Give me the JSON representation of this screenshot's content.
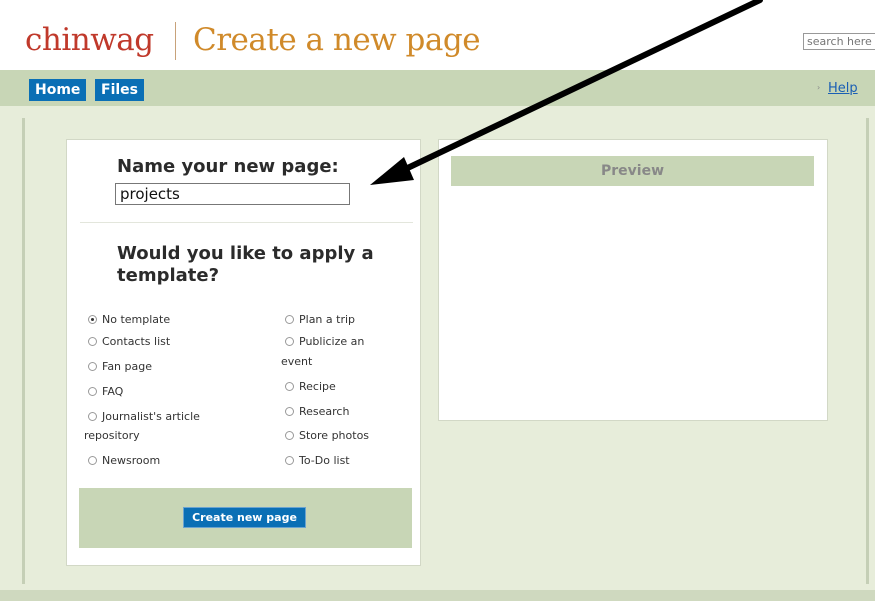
{
  "header": {
    "brand": "chinwag",
    "title": "Create a new page",
    "search_placeholder": "search here"
  },
  "nav": {
    "home": "Home",
    "files": "Files",
    "help": "Help",
    "help_marker": "›"
  },
  "form": {
    "name_heading": "Name your new page:",
    "name_value": "projects",
    "template_heading_1": "Would you like to apply a",
    "template_heading_2": "template?",
    "templates_left": [
      {
        "label": "No template",
        "checked": true
      },
      {
        "label": "Contacts list",
        "checked": false
      },
      {
        "label": "Fan page",
        "checked": false
      },
      {
        "label": "FAQ",
        "checked": false
      },
      {
        "label": "Journalist's article",
        "label_cont": "repository",
        "checked": false
      },
      {
        "label": "Newsroom",
        "checked": false
      }
    ],
    "templates_right": [
      {
        "label": "Plan a trip",
        "checked": false
      },
      {
        "label": "Publicize an",
        "label_cont": "event",
        "checked": false
      },
      {
        "label": "Recipe",
        "checked": false
      },
      {
        "label": "Research",
        "checked": false
      },
      {
        "label": "Store photos",
        "checked": false
      },
      {
        "label": "To-Do list",
        "checked": false
      }
    ],
    "submit_label": "Create new page"
  },
  "preview": {
    "label": "Preview"
  },
  "annotation": {
    "arrow_color": "#000000"
  }
}
